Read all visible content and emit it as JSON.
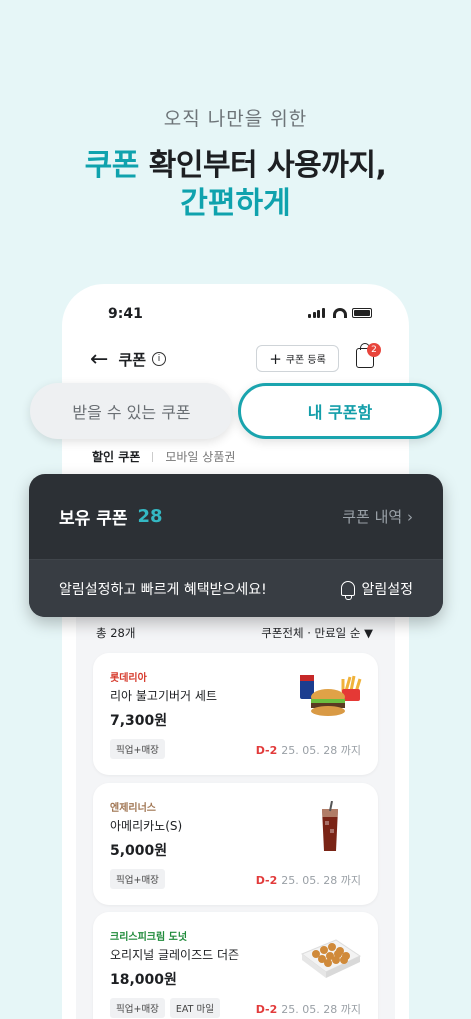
{
  "promo": {
    "subtitle": "오직 나만을 위한",
    "line1_accent": "쿠폰",
    "line1_rest": " 확인부터 사용까지,",
    "line2": "간편하게"
  },
  "status_bar": {
    "time": "9:41"
  },
  "nav": {
    "title": "쿠폰",
    "info_glyph": "i",
    "register_plus": "+",
    "register_label": "쿠폰 등록",
    "cart_badge": "2"
  },
  "tabs": {
    "available": "받을 수 있는 쿠폰",
    "mine": "내 쿠폰함"
  },
  "subtabs": {
    "discount": "할인 쿠폰",
    "mobile": "모바일 상품권"
  },
  "summary": {
    "title": "보유 쿠폰",
    "count": "28",
    "history_link": "쿠폰 내역 ›",
    "alert_message": "알림설정하고 빠르게 혜택받으세요!",
    "alert_button": "알림설정"
  },
  "list_meta": {
    "total": "총 28개",
    "sort": "쿠폰전체 · 만료일 순 ▼"
  },
  "coupons": [
    {
      "brand": "롯데리아",
      "brand_color": "#d63a2c",
      "name": "리아 불고기버거 세트",
      "price": "7,300원",
      "tags": [
        "픽업+매장"
      ],
      "dday": "D-2",
      "expiry": "25. 05. 28 까지"
    },
    {
      "brand": "엔제리너스",
      "brand_color": "#a07552",
      "name": "아메리카노(S)",
      "price": "5,000원",
      "tags": [
        "픽업+매장"
      ],
      "dday": "D-2",
      "expiry": "25. 05. 28 까지"
    },
    {
      "brand": "크리스피크림 도넛",
      "brand_color": "#1f8a3a",
      "name": "오리지널 글레이즈드 더즌",
      "price": "18,000원",
      "tags": [
        "픽업+매장",
        "EAT 마일"
      ],
      "dday": "D-2",
      "expiry": "25. 05. 28 까지"
    }
  ],
  "icons": [
    "back-arrow-icon",
    "info-icon",
    "plus-icon",
    "shopping-bag-icon",
    "bell-icon",
    "chevron-right-icon",
    "signal-icon",
    "wifi-icon",
    "battery-icon"
  ],
  "colors": {
    "accent": "#0fa2ad",
    "dark_card": "#2c3035",
    "dday_red": "#e23b3b",
    "background": "#e6f6f7"
  }
}
